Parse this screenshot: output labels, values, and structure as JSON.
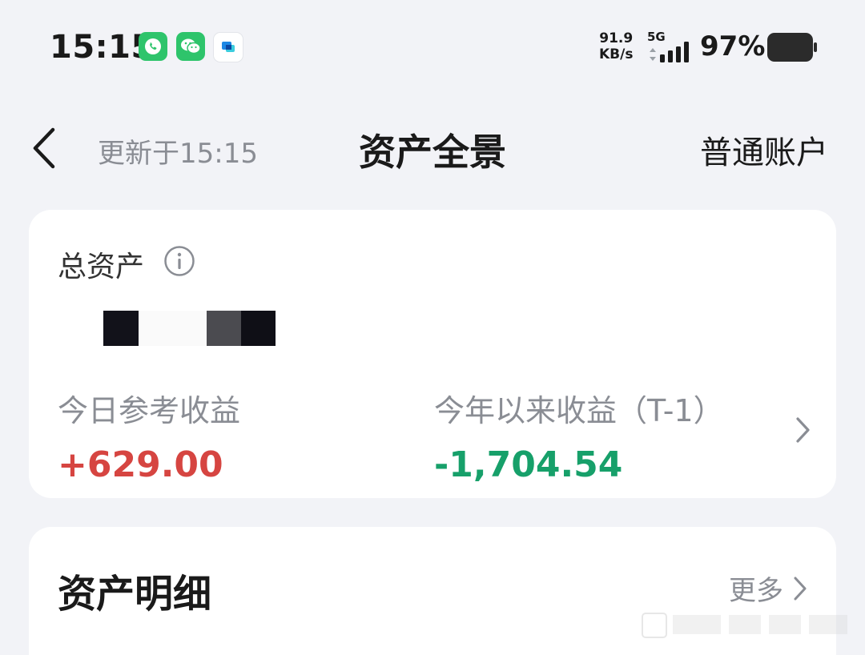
{
  "status_bar": {
    "time": "15:15",
    "net_speed_value": "91.9",
    "net_speed_unit": "KB/s",
    "network_type": "5G",
    "battery_percent": "97%",
    "app_icons": [
      "phone-call-icon",
      "wechat-icon",
      "message-app-icon"
    ]
  },
  "nav": {
    "update_time": "更新于15:15",
    "title": "资产全景",
    "account_type": "普通账户",
    "back_icon": "chevron-left-icon"
  },
  "summary": {
    "total_label": "总资产",
    "info_icon": "info-icon",
    "total_value_masked": true,
    "today_label": "今日参考收益",
    "today_value": "+629.00",
    "year_label": "今年以来收益（T-1）",
    "year_value": "-1,704.54",
    "colors": {
      "gain": "#d64541",
      "loss": "#17a06a"
    }
  },
  "detail": {
    "title": "资产明细",
    "more_label": "更多"
  }
}
